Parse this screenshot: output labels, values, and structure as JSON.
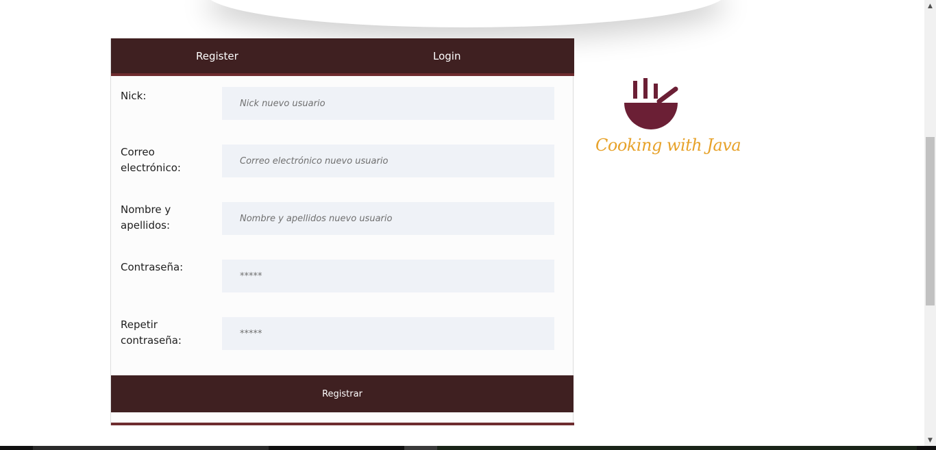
{
  "tabs": {
    "register": "Register",
    "login": "Login"
  },
  "form": {
    "fields": [
      {
        "label": "Nick:",
        "placeholder": "Nick nuevo usuario",
        "value": ""
      },
      {
        "label": "Correo electrónico:",
        "placeholder": "Correo electrónico nuevo usuario",
        "value": ""
      },
      {
        "label": "Nombre y apellidos:",
        "placeholder": "Nombre y apellidos nuevo usuario",
        "value": ""
      },
      {
        "label": "Contraseña:",
        "placeholder": "*****",
        "value": ""
      },
      {
        "label": "Repetir contraseña:",
        "placeholder": "*****",
        "value": ""
      }
    ],
    "submit_label": "Registrar"
  },
  "logo": {
    "text": "Cooking with Java",
    "icon": "bowl-steam-icon",
    "icon_color": "#6b1f35",
    "text_color": "#e7a22a"
  },
  "colors": {
    "header_bg": "#3f2021",
    "accent": "#6e2c2f",
    "input_bg": "#eff2f7"
  }
}
